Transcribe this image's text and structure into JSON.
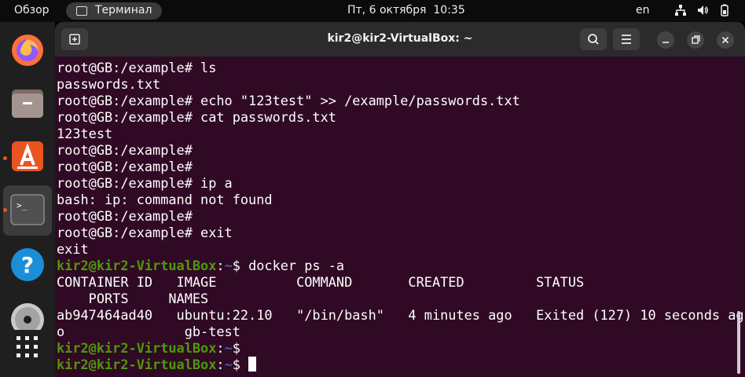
{
  "topbar": {
    "activities": "Обзор",
    "app_name": "Терминал",
    "clock": "Пт, 6 октября  10:35",
    "language": "en"
  },
  "dock": {
    "items": [
      "firefox-icon",
      "files-icon",
      "app-center-icon",
      "terminal-icon",
      "help-icon",
      "disc-icon",
      "app-grid-icon"
    ]
  },
  "window": {
    "title": "kir2@kir2-VirtualBox: ~"
  },
  "terminal": {
    "lines": [
      {
        "text": "root@GB:/example# ls"
      },
      {
        "text": "passwords.txt"
      },
      {
        "text": "root@GB:/example# echo \"123test\" >> /example/passwords.txt"
      },
      {
        "text": "root@GB:/example# cat passwords.txt"
      },
      {
        "text": "123test"
      },
      {
        "text": "root@GB:/example#"
      },
      {
        "text": "root@GB:/example#"
      },
      {
        "text": "root@GB:/example# ip a"
      },
      {
        "text": "bash: ip: command not found"
      },
      {
        "text": "root@GB:/example#"
      },
      {
        "text": "root@GB:/example# exit"
      },
      {
        "text": "exit"
      },
      {
        "user_host": "kir2@kir2-VirtualBox",
        "sep": ":",
        "path": "~",
        "cmd": "$ docker ps -a"
      },
      {
        "text": "CONTAINER ID   IMAGE          COMMAND       CREATED         STATUS"
      },
      {
        "text": "    PORTS     NAMES"
      },
      {
        "text": "ab947464ad40   ubuntu:22.10   \"/bin/bash\"   4 minutes ago   Exited (127) 10 seconds ag"
      },
      {
        "text": "o               gb-test"
      },
      {
        "user_host": "kir2@kir2-VirtualBox",
        "sep": ":",
        "path": "~",
        "cmd": "$"
      },
      {
        "user_host": "kir2@kir2-VirtualBox",
        "sep": ":",
        "path": "~",
        "cmd": "$ ",
        "cursor": true
      }
    ]
  }
}
